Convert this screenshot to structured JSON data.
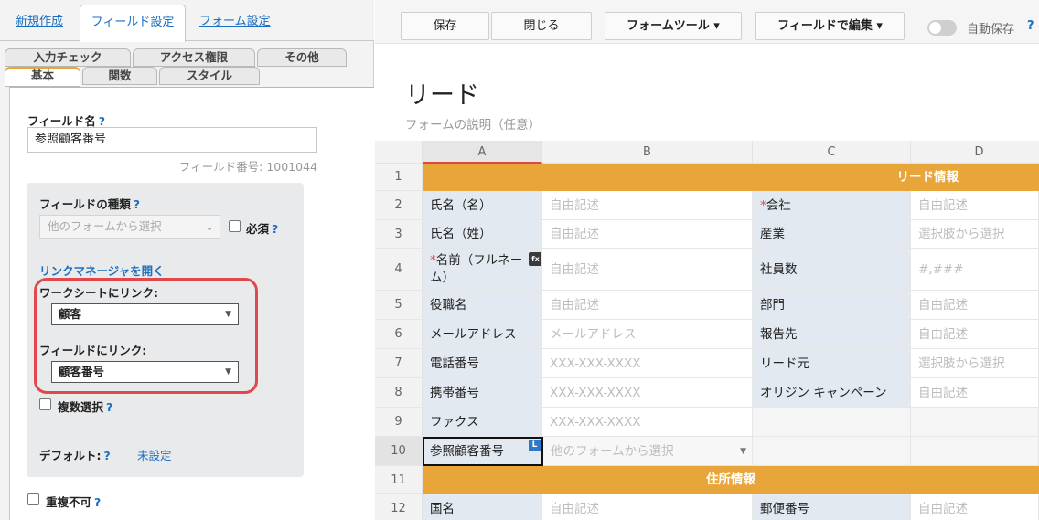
{
  "left_panel": {
    "top_tabs": [
      "新規作成",
      "フィールド設定",
      "フォーム設定"
    ],
    "sub_tabs_row1": [
      "入力チェック",
      "アクセス権限",
      "その他"
    ],
    "sub_tabs_row2": [
      "基本",
      "関数",
      "スタイル"
    ],
    "field_name_label": "フィールド名",
    "help": "?",
    "field_name_value": "参照顧客番号",
    "field_number": "フィールド番号: 1001044",
    "field_type_label": "フィールドの種類",
    "field_type_value": "他のフォームから選択",
    "required_label": "必須",
    "link_manager": "リンクマネージャを開く",
    "worksheet_link_label": "ワークシートにリンク:",
    "worksheet_link_value": "顧客",
    "field_link_label": "フィールドにリンク:",
    "field_link_value": "顧客番号",
    "multi_select_label": "複数選択",
    "default_label": "デフォルト:",
    "default_value": "未設定",
    "no_duplicate_label": "重複不可"
  },
  "toolbar": {
    "save": "保存",
    "close": "閉じる",
    "form_tools": "フォームツール ▾",
    "edit_by_field": "フィールドで編集 ▾",
    "autosave": "自動保存",
    "help": "?"
  },
  "form": {
    "title": "リード",
    "description": "フォームの説明（任意）",
    "columns": [
      "A",
      "B",
      "C",
      "D"
    ],
    "rows": [
      "1",
      "2",
      "3",
      "4",
      "5",
      "6",
      "7",
      "8",
      "9",
      "10",
      "11",
      "12"
    ],
    "section_lead": "リード情報",
    "section_address": "住所情報",
    "fields_left": [
      {
        "label": "氏名（名）",
        "placeholder": "自由記述"
      },
      {
        "label": "氏名（姓）",
        "placeholder": "自由記述"
      },
      {
        "label": "名前（フルネーム）",
        "placeholder": "自由記述"
      },
      {
        "label": "役職名",
        "placeholder": "自由記述"
      },
      {
        "label": "メールアドレス",
        "placeholder": "メールアドレス"
      },
      {
        "label": "電話番号",
        "placeholder": "XXX-XXX-XXXX"
      },
      {
        "label": "携帯番号",
        "placeholder": "XXX-XXX-XXXX"
      },
      {
        "label": "ファクス",
        "placeholder": "XXX-XXX-XXXX"
      },
      {
        "label": "参照顧客番号",
        "placeholder": "他のフォームから選択"
      }
    ],
    "fields_right": [
      {
        "label": "会社",
        "placeholder": "自由記述"
      },
      {
        "label": "産業",
        "placeholder": "選択肢から選択"
      },
      {
        "label": "社員数",
        "placeholder": "#,###"
      },
      {
        "label": "部門",
        "placeholder": "自由記述"
      },
      {
        "label": "報告先",
        "placeholder": "自由記述"
      },
      {
        "label": "リード元",
        "placeholder": "選択肢から選択"
      },
      {
        "label": "オリジン キャンペーン",
        "placeholder": "自由記述"
      }
    ],
    "row12": {
      "left_label": "国名",
      "left_placeholder": "自由記述",
      "right_label": "郵便番号",
      "right_placeholder": "自由記述"
    },
    "fx_badge": "fx",
    "l_badge": "L",
    "star": "*"
  },
  "colors": {
    "accent": "#e8a63a",
    "highlight": "#e0484b",
    "link": "#1a6fc1",
    "label_cell": "#e3e9f1"
  }
}
